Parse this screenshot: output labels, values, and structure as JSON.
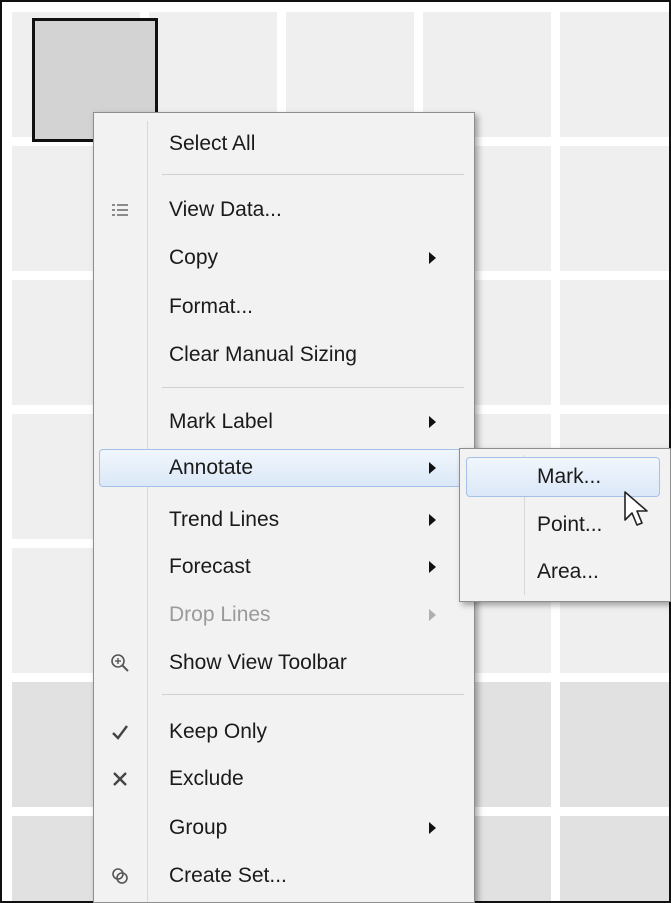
{
  "context_menu": {
    "items": [
      {
        "label": "Select All",
        "icon": "",
        "submenu": false,
        "disabled": false
      },
      {
        "label": "View Data...",
        "icon": "data-grid-icon",
        "submenu": false,
        "disabled": false
      },
      {
        "label": "Copy",
        "icon": "",
        "submenu": true,
        "disabled": false
      },
      {
        "label": "Format...",
        "icon": "",
        "submenu": false,
        "disabled": false
      },
      {
        "label": "Clear Manual Sizing",
        "icon": "",
        "submenu": false,
        "disabled": false
      },
      {
        "label": "Mark Label",
        "icon": "",
        "submenu": true,
        "disabled": false
      },
      {
        "label": "Annotate",
        "icon": "",
        "submenu": true,
        "disabled": false,
        "highlighted": true
      },
      {
        "label": "Trend Lines",
        "icon": "",
        "submenu": true,
        "disabled": false
      },
      {
        "label": "Forecast",
        "icon": "",
        "submenu": true,
        "disabled": false
      },
      {
        "label": "Drop Lines",
        "icon": "",
        "submenu": true,
        "disabled": true
      },
      {
        "label": "Show View Toolbar",
        "icon": "zoom-in-icon",
        "submenu": false,
        "disabled": false
      },
      {
        "label": "Keep Only",
        "icon": "checkmark-icon",
        "submenu": false,
        "disabled": false
      },
      {
        "label": "Exclude",
        "icon": "x-icon",
        "submenu": false,
        "disabled": false
      },
      {
        "label": "Group",
        "icon": "",
        "submenu": true,
        "disabled": false
      },
      {
        "label": "Create Set...",
        "icon": "create-set-icon",
        "submenu": false,
        "disabled": false
      }
    ]
  },
  "annotate_submenu": {
    "items": [
      {
        "label": "Mark...",
        "highlighted": true
      },
      {
        "label": "Point..."
      },
      {
        "label": "Area..."
      }
    ]
  },
  "colors": {
    "menu_background": "#f2f2f2",
    "highlight_border": "#a4c2e8",
    "cell": "#efefef",
    "selected_mark": "#d3d3d3"
  }
}
